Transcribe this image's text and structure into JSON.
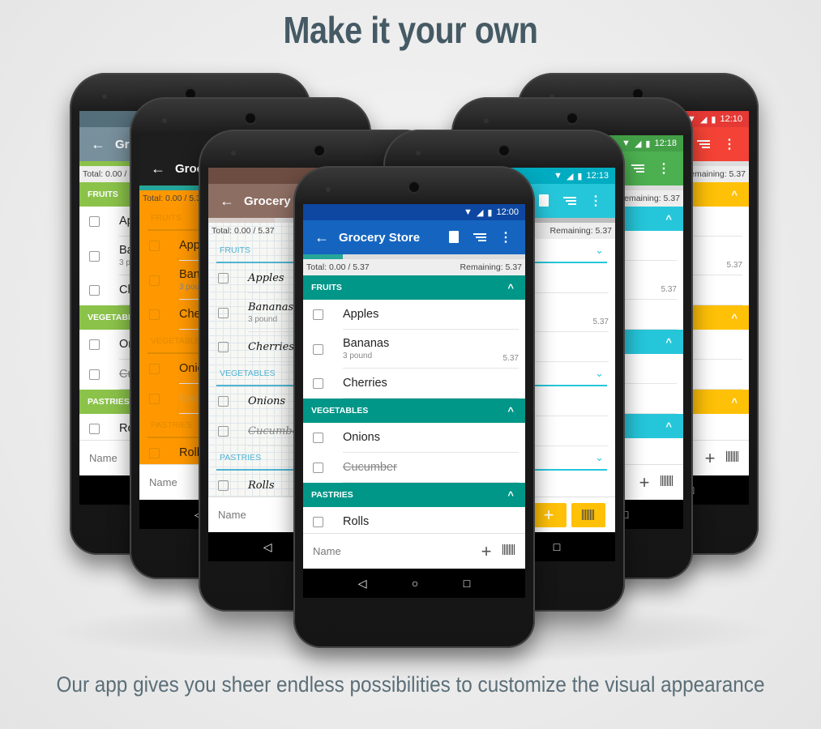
{
  "headline": "Make it your own",
  "caption": "Our app gives you sheer endless possibilities to customize the visual appearance",
  "list": {
    "title": "Grocery Store",
    "total": "Total: 0.00 / 5.37",
    "remaining": "Remaining: 5.37",
    "input_placeholder": "Name",
    "sections": [
      {
        "name": "FRUITS",
        "items": [
          {
            "name": "Apples"
          },
          {
            "name": "Bananas",
            "sub": "3 pound",
            "price": "5.37"
          },
          {
            "name": "Cherries"
          }
        ]
      },
      {
        "name": "VEGETABLES",
        "items": [
          {
            "name": "Onions"
          },
          {
            "name": "Cucumber",
            "done": true
          }
        ]
      },
      {
        "name": "PASTRIES",
        "items": [
          {
            "name": "Rolls"
          }
        ]
      }
    ],
    "nav": [
      "◁",
      "○",
      "□"
    ]
  },
  "phones": [
    {
      "id": "bluegrey-green",
      "time": "",
      "status": "#546e7a",
      "toolbar": "#78909c",
      "progress_color": "#8bc34a",
      "progress": 0.28,
      "section": "#8bc34a",
      "header_style": "bar",
      "bg": "#ffffff",
      "text": "#222222"
    },
    {
      "id": "orange",
      "time": "",
      "status": "#1e1e1e",
      "toolbar": "#1e1e1e",
      "progress_color": "#26a69a",
      "progress": 0.5,
      "section": "#e08a00",
      "header_style": "line",
      "bg": "#ff9800",
      "text": "#3a2200"
    },
    {
      "id": "notebook",
      "time": "",
      "status": "#6d4c41",
      "toolbar": "#8d6e63",
      "progress_color": "#d7ccc8",
      "progress": 0.3,
      "section": "#4fb3d1",
      "header_style": "line",
      "bg": "#f7f7f4",
      "text": "#111111",
      "handwriting": true
    },
    {
      "id": "blue-teal",
      "time": "12:00",
      "status": "#0d47a1",
      "toolbar": "#1565c0",
      "progress_color": "#26a69a",
      "progress": 0.18,
      "section": "#009688",
      "header_style": "bar",
      "bg": "#ffffff",
      "text": "#222222"
    },
    {
      "id": "cyan-yellow",
      "time": "12:13",
      "status": "#00acc1",
      "toolbar": "#26c6da",
      "progress_color": "#bdbdbd",
      "progress": 1,
      "section": "#26c6da",
      "header_style": "dropdown",
      "bg": "#ffffff",
      "text": "#222222",
      "yellow_buttons": true
    },
    {
      "id": "green-cyan",
      "time": "12:18",
      "status": "#43a047",
      "toolbar": "#4caf50",
      "progress_color": "#e0e0e0",
      "progress": 0,
      "section": "#26c6da",
      "header_style": "bar",
      "bg": "#ffffff",
      "text": "#222222"
    },
    {
      "id": "red-amber",
      "time": "12:10",
      "status": "#e53935",
      "toolbar": "#f44336",
      "progress_color": "#e0e0e0",
      "progress": 0,
      "section": "#ffc107",
      "header_style": "bar",
      "bg": "#ffffff",
      "text": "#222222"
    }
  ]
}
